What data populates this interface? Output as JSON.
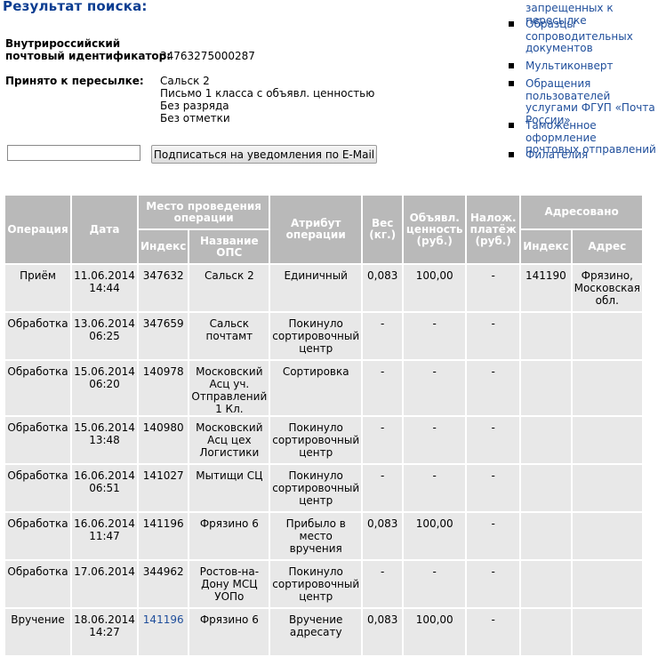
{
  "page_title": "Результат поиска:",
  "info": {
    "rpo_label_line1": "Внутрироссийский",
    "rpo_label_line2": "почтовый идентификатор:",
    "rpo_value": "34763275000287",
    "accepted_label": "Принято к пересылке:",
    "accepted_lines": [
      "Сальск 2",
      "Письмо 1 класса с объявл. ценностью",
      "Без разряда",
      "Без отметки"
    ]
  },
  "subscribe": {
    "email_value": "",
    "button_label": "Подписаться на уведомления по E-Mail"
  },
  "sidebar": {
    "items": [
      {
        "lines": [
          "запрещенных к пересылке"
        ]
      },
      {
        "lines": [
          "Образцы",
          "сопроводительных",
          "документов"
        ]
      },
      {
        "lines": [
          "Мультиконверт"
        ]
      },
      {
        "lines": [
          "Обращения пользователей",
          "услугами ФГУП «Почта",
          "России»"
        ]
      },
      {
        "lines": [
          "Таможенное оформление",
          "почтовых отправлений"
        ]
      },
      {
        "lines": [
          "Филателия"
        ]
      }
    ]
  },
  "table": {
    "headers": {
      "operation": "Операция",
      "date": "Дата",
      "place_group": [
        "Место проведения",
        "операции"
      ],
      "index": "Индекс",
      "ops_name": [
        "Название",
        "ОПС"
      ],
      "attribute": [
        "Атрибут",
        "операции"
      ],
      "weight": [
        "Вес",
        "(кг.)"
      ],
      "declared": [
        "Объявл.",
        "ценность",
        "(руб.)"
      ],
      "cod": [
        "Налож.",
        "платёж",
        "(руб.)"
      ],
      "addressed": "Адресовано",
      "addr_index": "Индекс",
      "addr_address": "Адрес"
    },
    "rows": [
      {
        "op": "Приём",
        "date": [
          "11.06.2014",
          "14:44"
        ],
        "index": "347632",
        "name": [
          "Сальск 2"
        ],
        "attr": [
          "Единичный"
        ],
        "weight": "0,083",
        "declared": "100,00",
        "cod": "-",
        "addr_index": "141190",
        "addr": [
          "Фрязино,",
          "Московская",
          "обл."
        ]
      },
      {
        "op": "Обработка",
        "date": [
          "13.06.2014",
          "06:25"
        ],
        "index": "347659",
        "name": [
          "Сальск",
          "почтамт"
        ],
        "attr": [
          "Покинуло",
          "сортировочный",
          "центр"
        ],
        "weight": "-",
        "declared": "-",
        "cod": "-",
        "addr_index": "",
        "addr": []
      },
      {
        "op": "Обработка",
        "date": [
          "15.06.2014",
          "06:20"
        ],
        "index": "140978",
        "name": [
          "Московский",
          "Асц уч.",
          "Отправлений",
          "1 Кл."
        ],
        "attr": [
          "Сортировка"
        ],
        "weight": "-",
        "declared": "-",
        "cod": "-",
        "addr_index": "",
        "addr": []
      },
      {
        "op": "Обработка",
        "date": [
          "15.06.2014",
          "13:48"
        ],
        "index": "140980",
        "name": [
          "Московский",
          "Асц цех",
          "Логистики"
        ],
        "attr": [
          "Покинуло",
          "сортировочный",
          "центр"
        ],
        "weight": "-",
        "declared": "-",
        "cod": "-",
        "addr_index": "",
        "addr": []
      },
      {
        "op": "Обработка",
        "date": [
          "16.06.2014",
          "06:51"
        ],
        "index": "141027",
        "name": [
          "Мытищи СЦ"
        ],
        "attr": [
          "Покинуло",
          "сортировочный",
          "центр"
        ],
        "weight": "-",
        "declared": "-",
        "cod": "-",
        "addr_index": "",
        "addr": []
      },
      {
        "op": "Обработка",
        "date": [
          "16.06.2014",
          "11:47"
        ],
        "index": "141196",
        "name": [
          "Фрязино 6"
        ],
        "attr": [
          "Прибыло в",
          "место",
          "вручения"
        ],
        "weight": "0,083",
        "declared": "100,00",
        "cod": "-",
        "addr_index": "",
        "addr": []
      },
      {
        "op": "Обработка",
        "date": [
          "17.06.2014"
        ],
        "index": "344962",
        "name": [
          "Ростов-на-",
          "Дону МСЦ",
          "УОПо"
        ],
        "attr": [
          "Покинуло",
          "сортировочный",
          "центр"
        ],
        "weight": "-",
        "declared": "-",
        "cod": "-",
        "addr_index": "",
        "addr": []
      },
      {
        "op": "Вручение",
        "date": [
          "18.06.2014",
          "14:27"
        ],
        "index": "141196",
        "index_link": true,
        "name": [
          "Фрязино 6"
        ],
        "attr": [
          "Вручение",
          "адресату"
        ],
        "weight": "0,083",
        "declared": "100,00",
        "cod": "-",
        "addr_index": "",
        "addr": []
      }
    ]
  }
}
